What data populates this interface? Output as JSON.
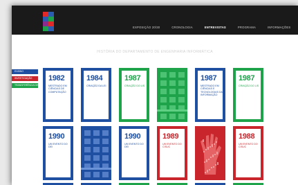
{
  "logo": {
    "name": "logo-icon",
    "colors": [
      "#e02a2a",
      "#2a5db0",
      "#1ea34a",
      "#8b2c8f"
    ]
  },
  "nav": [
    {
      "label": "EXPOSIÇÃO 20/30",
      "active": false
    },
    {
      "label": "CRONOLOGIA",
      "active": false
    },
    {
      "label": "ENTREVISTAS",
      "active": true
    },
    {
      "label": "PROGRAMA",
      "active": false
    },
    {
      "label": "INFORMAÇÕES",
      "active": false
    }
  ],
  "page_title": "HISTÓRIA DO DEPARTAMENTO DE ENGENHARIA INFORMÁTICA",
  "side_tabs": [
    {
      "label": "ENSINO",
      "color": "#1f4fa0"
    },
    {
      "label": "INVESTIGAÇÃO",
      "color": "#c8262c"
    },
    {
      "label": "TRANSFERÊNCIA DE TECNOLOGIA",
      "color": "#1ea34a"
    }
  ],
  "tiles_row1": [
    {
      "year": "1982",
      "desc": "MESTRADO EM CIÊNCIAS DE COMPUTAÇÃO",
      "color": "#1f4fa0"
    },
    {
      "year": "1984",
      "desc": "CRIAÇÃO DA LEI",
      "color": "#1f4fa0"
    },
    {
      "year": "1987",
      "desc": "CRIAÇÃO DO LIS",
      "color": "#1ea34a"
    },
    {
      "image": "building-photo-green",
      "color": "#1ea34a"
    },
    {
      "year": "1987",
      "desc": "MESTRADO EM CIÊNCIAS E TECNOLOGIAS DA INFORMAÇÃO",
      "color": "#1f4fa0"
    },
    {
      "year": "1987",
      "desc": "CRIAÇÃO DO LIS",
      "color": "#1ea34a"
    }
  ],
  "tiles_row2": [
    {
      "year": "1990",
      "desc": "UM EVENTO DO DEI",
      "color": "#1f4fa0"
    },
    {
      "image": "building-photo-blue",
      "color": "#1f4fa0"
    },
    {
      "year": "1990",
      "desc": "UM EVENTO DO DEI",
      "color": "#1f4fa0"
    },
    {
      "year": "1989",
      "desc": "UM EVENTO DO CISUC",
      "color": "#c8262c"
    },
    {
      "image": "glove-photo-red",
      "color": "#c8262c"
    },
    {
      "year": "1988",
      "desc": "UM EVENTO DO CISUC",
      "color": "#c8262c"
    }
  ]
}
